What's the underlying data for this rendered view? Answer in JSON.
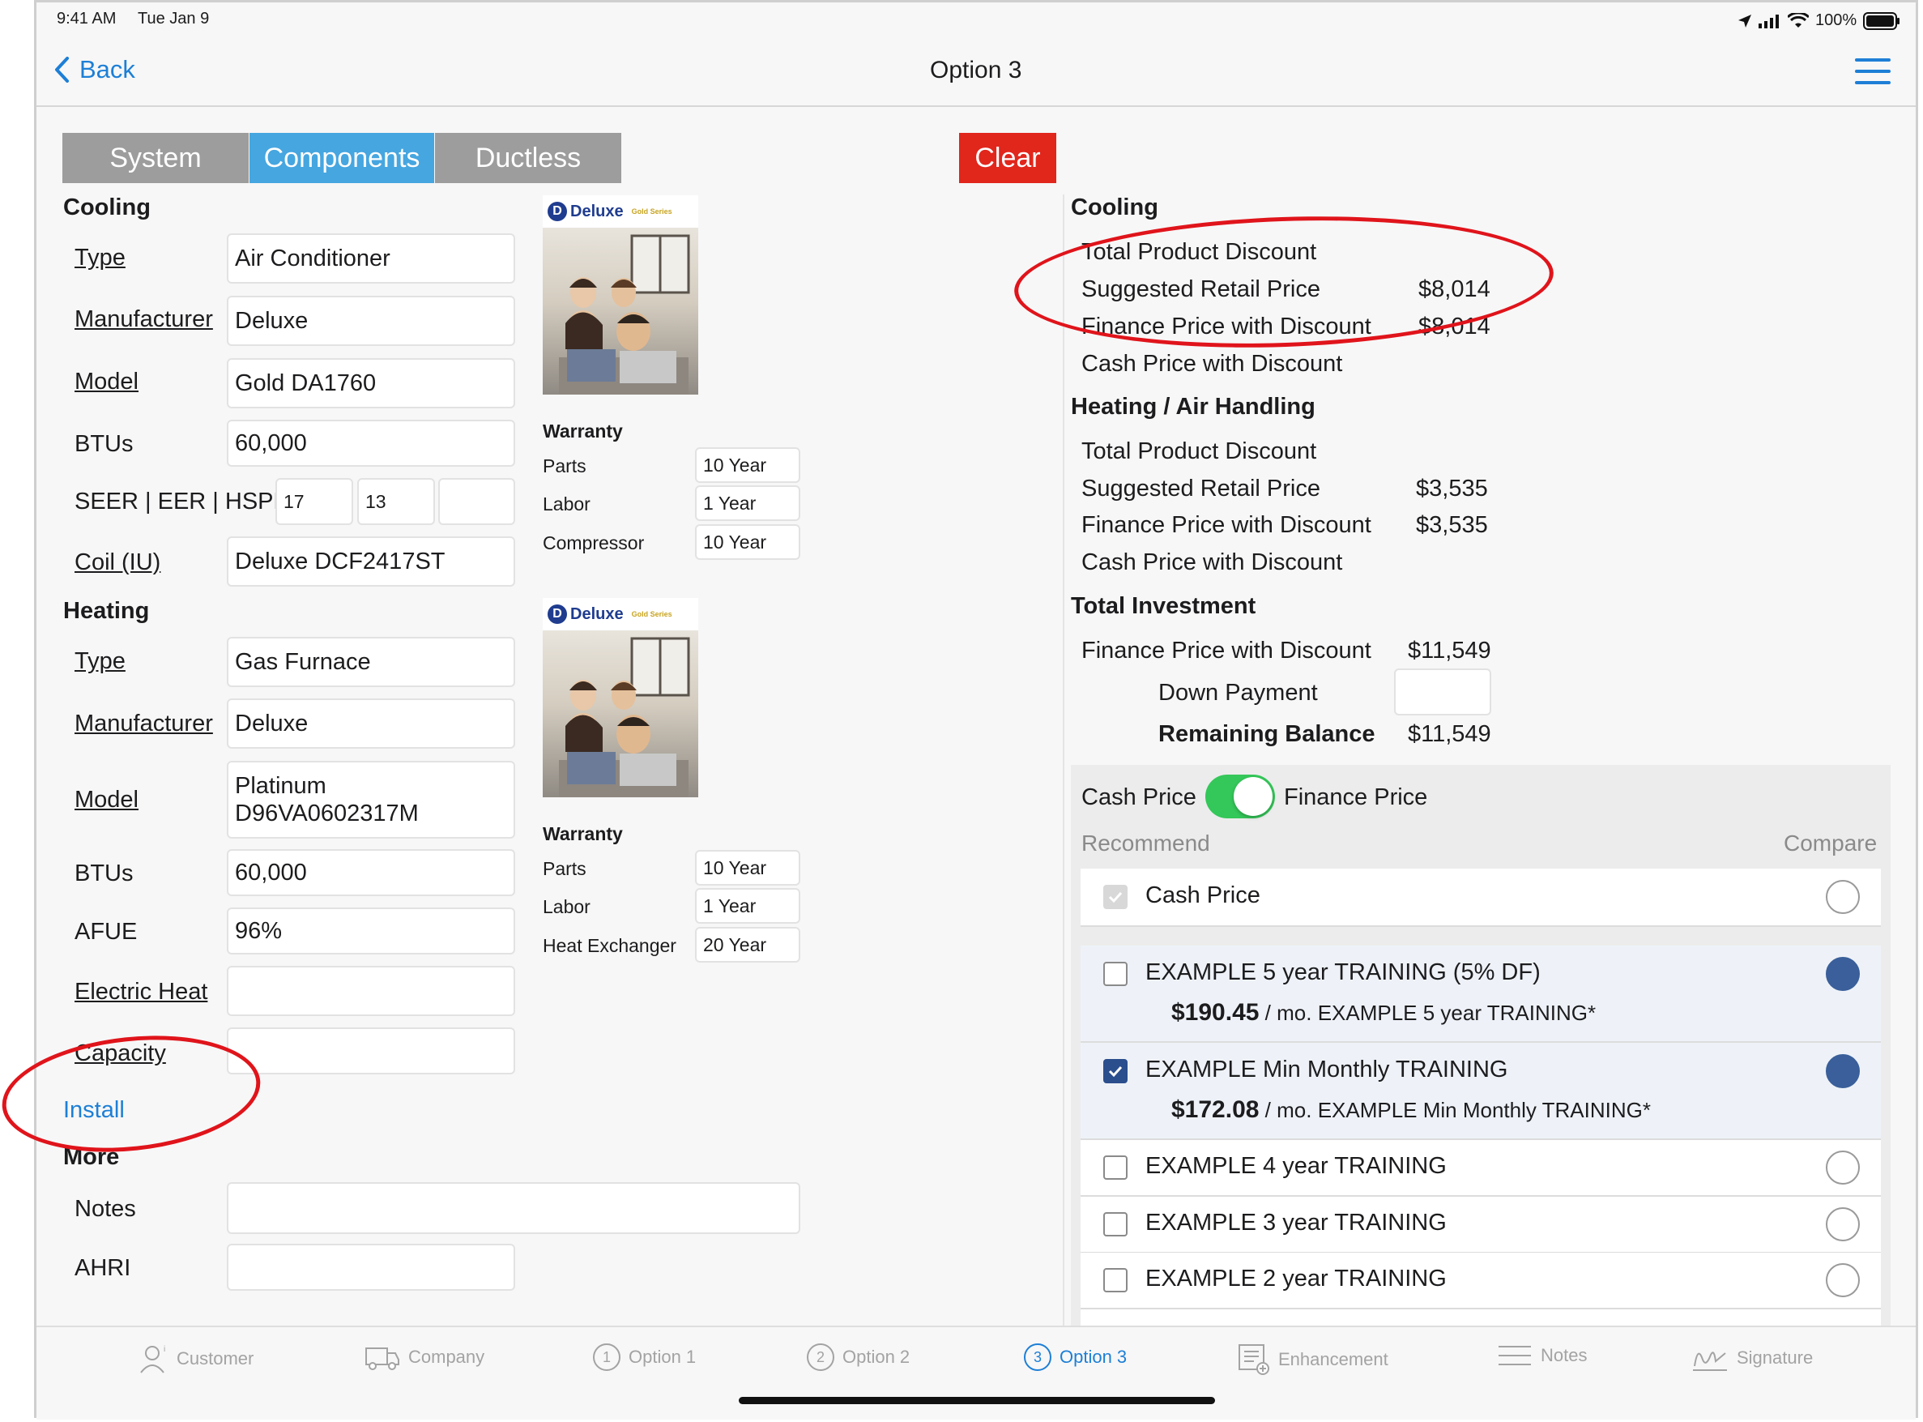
{
  "status_bar": {
    "time": "9:41 AM",
    "date": "Tue Jan 9",
    "battery": "100%"
  },
  "nav": {
    "back_label": "Back",
    "title": "Option 3"
  },
  "segments": [
    {
      "label": "System",
      "active": false
    },
    {
      "label": "Components",
      "active": true
    },
    {
      "label": "Ductless",
      "active": false
    }
  ],
  "clear_label": "Clear",
  "cooling": {
    "heading": "Cooling",
    "type_label": "Type",
    "type_value": "Air Conditioner",
    "manufacturer_label": "Manufacturer",
    "manufacturer_value": "Deluxe",
    "model_label": "Model",
    "model_value": "Gold DA1760",
    "btus_label": "BTUs",
    "btus_value": "60,000",
    "seer_label": "SEER | EER | HSPF",
    "seer_value": "17",
    "eer_value": "13",
    "hspf_value": "",
    "coil_label": "Coil (IU)",
    "coil_value": "Deluxe DCF2417ST",
    "warranty": {
      "heading": "Warranty",
      "rows": [
        {
          "label": "Parts",
          "value": "10 Year"
        },
        {
          "label": "Labor",
          "value": "1 Year"
        },
        {
          "label": "Compressor",
          "value": "10 Year"
        }
      ]
    },
    "image_logo": "Deluxe"
  },
  "heating": {
    "heading": "Heating",
    "type_label": "Type",
    "type_value": "Gas Furnace",
    "manufacturer_label": "Manufacturer",
    "manufacturer_value": "Deluxe",
    "model_label": "Model",
    "model_value_line1": "Platinum",
    "model_value_line2": "D96VA0602317M",
    "btus_label": "BTUs",
    "btus_value": "60,000",
    "afue_label": "AFUE",
    "afue_value": "96%",
    "electric_heat_label": "Electric Heat",
    "electric_heat_value": "",
    "capacity_label": "Capacity",
    "capacity_value": "",
    "warranty": {
      "heading": "Warranty",
      "rows": [
        {
          "label": "Parts",
          "value": "10 Year"
        },
        {
          "label": "Labor",
          "value": "1 Year"
        },
        {
          "label": "Heat Exchanger",
          "value": "20 Year"
        }
      ]
    },
    "image_logo": "Deluxe"
  },
  "install_link": "Install",
  "more": {
    "heading": "More",
    "notes_label": "Notes",
    "notes_value": "",
    "ahri_label": "AHRI",
    "ahri_value": ""
  },
  "summary": {
    "cooling": {
      "heading": "Cooling",
      "total_discount_label": "Total Product Discount",
      "retail_label": "Suggested Retail Price",
      "retail_value": "$8,014",
      "finance_label": "Finance Price with Discount",
      "finance_value": "$8,014",
      "cash_label": "Cash Price with Discount"
    },
    "heating": {
      "heading": "Heating / Air Handling",
      "total_discount_label": "Total Product Discount",
      "retail_label": "Suggested Retail Price",
      "retail_value": "$3,535",
      "finance_label": "Finance Price with Discount",
      "finance_value": "$3,535",
      "cash_label": "Cash Price with Discount"
    },
    "total": {
      "heading": "Total Investment",
      "finance_label": "Finance Price with Discount",
      "finance_value": "$11,549",
      "down_label": "Down Payment",
      "down_value": "",
      "remaining_label": "Remaining Balance",
      "remaining_value": "$11,549"
    }
  },
  "pricing": {
    "cash_label": "Cash Price",
    "finance_label": "Finance Price",
    "toggle_on": true,
    "recommend_label": "Recommend",
    "compare_label": "Compare",
    "options": [
      {
        "label": "Cash Price",
        "sub_amount": "",
        "sub_text": "",
        "checked": false,
        "disabled": true,
        "compare": false
      },
      {
        "label": "EXAMPLE 5 year TRAINING (5% DF)",
        "sub_amount": "$190.45",
        "sub_text": " / mo. EXAMPLE 5 year TRAINING*",
        "checked": false,
        "disabled": false,
        "compare": true
      },
      {
        "label": "EXAMPLE Min Monthly TRAINING",
        "sub_amount": "$172.08",
        "sub_text": " / mo. EXAMPLE Min Monthly TRAINING*",
        "checked": true,
        "disabled": false,
        "compare": true
      },
      {
        "label": "EXAMPLE 4 year TRAINING",
        "sub_amount": "",
        "sub_text": "",
        "checked": false,
        "disabled": false,
        "compare": false
      },
      {
        "label": "EXAMPLE 3 year TRAINING",
        "sub_amount": "",
        "sub_text": "",
        "checked": false,
        "disabled": false,
        "compare": false
      },
      {
        "label": "EXAMPLE 2 year TRAINING",
        "sub_amount": "",
        "sub_text": "",
        "checked": false,
        "disabled": false,
        "compare": false
      }
    ]
  },
  "tabs": [
    {
      "label": "Customer",
      "icon": "customer-icon",
      "active": false
    },
    {
      "label": "Company",
      "icon": "truck-icon",
      "active": false
    },
    {
      "label": "Option 1",
      "icon": "option-1-icon",
      "num": "1",
      "active": false
    },
    {
      "label": "Option 2",
      "icon": "option-2-icon",
      "num": "2",
      "active": false
    },
    {
      "label": "Option 3",
      "icon": "option-3-icon",
      "num": "3",
      "active": true
    },
    {
      "label": "Enhancement",
      "icon": "enhancement-icon",
      "active": false
    },
    {
      "label": "Notes",
      "icon": "notes-icon",
      "active": false
    },
    {
      "label": "Signature",
      "icon": "signature-icon",
      "active": false
    }
  ],
  "colors": {
    "accent": "#1d7fd6",
    "clear": "#e1261c",
    "toggle": "#34c759",
    "annotation": "#e0141b",
    "checked": "#2b4e8c"
  }
}
